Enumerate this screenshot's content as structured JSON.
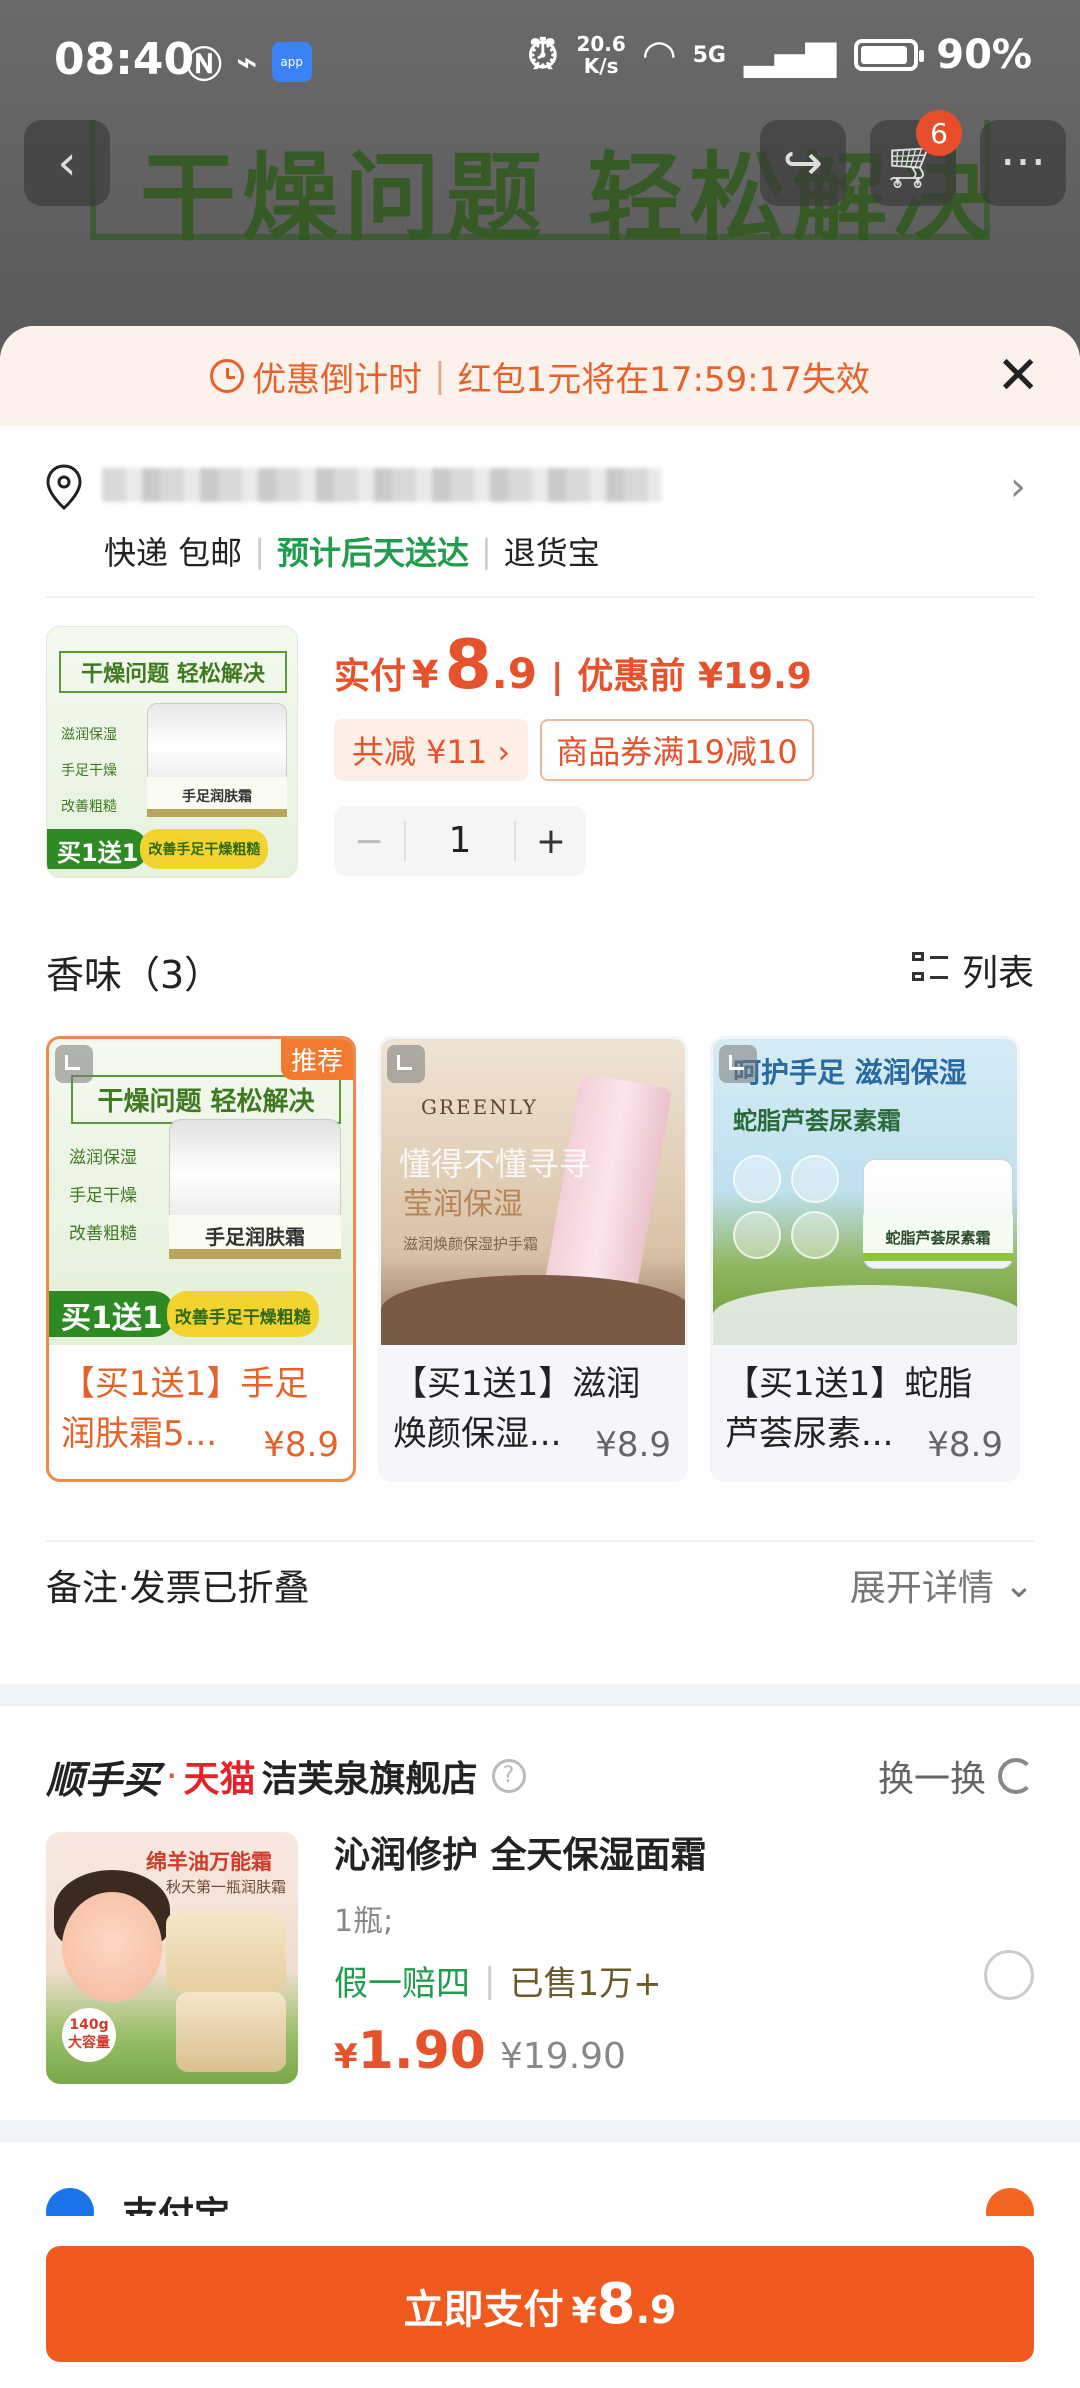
{
  "status_bar": {
    "time": "08:40",
    "net_speed_value": "20.6",
    "net_speed_unit": "K/s",
    "signal": "5G",
    "battery": "90%"
  },
  "background_page": {
    "banner_text": "干燥问题 轻松解决",
    "cart_count": "6"
  },
  "countdown": {
    "label": "优惠倒计时",
    "message": "红包1元将在17:59:17失效"
  },
  "address": {
    "shipping": "快递 包邮",
    "delivery": "预计后天送达",
    "returns": "退货宝"
  },
  "product": {
    "thumb_title": "干燥问题 轻松解决",
    "thumb_features": [
      "滋润保湿",
      "手足干燥",
      "改善粗糙"
    ],
    "thumb_jar_label": "手足润肤霜",
    "thumb_promo_left": "买1送1",
    "thumb_promo_right": "改善手足干燥粗糙",
    "pay_label": "实付",
    "currency": "¥",
    "pay_int": "8",
    "pay_dec": ".9",
    "pre_label": "优惠前 ¥19.9",
    "save_tag": "共减 ¥11 ›",
    "coupon_tag": "商品券满19减10",
    "quantity": "1"
  },
  "variants_section": {
    "title": "香味（3）",
    "view_label": "列表",
    "recommend_badge": "推荐",
    "items": [
      {
        "name": "【买1送1】手足润肤霜5...",
        "price": "¥8.9",
        "img_title": "干燥问题 轻松解决",
        "img_features": [
          "滋润保湿",
          "手足干燥",
          "改善粗糙"
        ],
        "img_label": "手足润肤霜",
        "img_promo_left": "买1送1",
        "img_promo_right": "改善手足干燥粗糙"
      },
      {
        "name": "【买1送1】滋润焕颜保湿...",
        "price": "¥8.9",
        "img_brand": "GREENLY",
        "img_watermark": "懂得不懂寻寻",
        "img_tagline": "莹润保湿",
        "img_sub": "滋润焕颜保湿护手霜"
      },
      {
        "name": "【买1送1】蛇脂芦荟尿素...",
        "price": "¥8.9",
        "img_head": "呵护手足 滋润保湿",
        "img_sub": "蛇脂芦荟尿素霜",
        "img_label": "蛇脂芦荟尿素霜"
      }
    ]
  },
  "note_row": {
    "label": "备注·发票已折叠",
    "expand": "展开详情"
  },
  "recommendation": {
    "brand_sx": "顺手买",
    "brand_dot": "·",
    "brand_tmall": "天猫",
    "store_name": "洁芙泉旗舰店",
    "swap_label": "换一换",
    "thumb_t1": "绵羊油万能霜",
    "thumb_t2": "秋天第一瓶润肤霜",
    "thumb_badge": "140g 大容量",
    "title": "沁润修护 全天保湿面霜",
    "spec": "1瓶;",
    "guarantee": "假一赔四",
    "sold": "已售1万+",
    "currency": "¥",
    "price": "1.90",
    "old_price": "¥19.90"
  },
  "peek": {
    "text": "支付宝"
  },
  "pay_button": {
    "label": "立即支付",
    "currency": "¥",
    "int": "8",
    "dec": ".9"
  }
}
